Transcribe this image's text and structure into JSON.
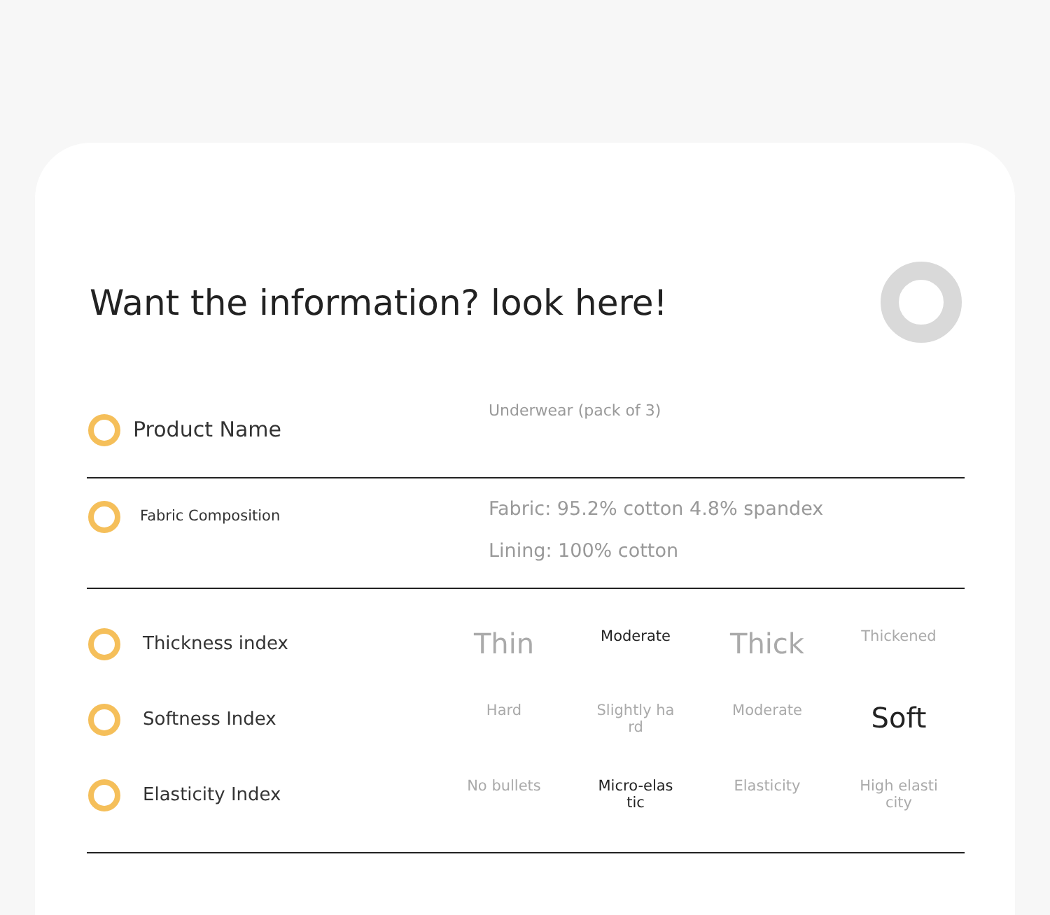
{
  "heading": "Want the information? look here!",
  "details": [
    {
      "label": "Product Name",
      "kind": "large",
      "values": [
        "Underwear (pack of 3)"
      ]
    },
    {
      "label": "Fabric Composition",
      "kind": "small",
      "values": [
        "Fabric: 95.2% cotton 4.8% spandex",
        "Lining: 100% cotton"
      ]
    }
  ],
  "indexes": [
    {
      "label": "Thickness index",
      "options": [
        {
          "text": "Thin",
          "selected": false,
          "emphasis": true
        },
        {
          "text": "Moderate",
          "selected": true,
          "emphasis": false
        },
        {
          "text": "Thick",
          "selected": false,
          "emphasis": true
        },
        {
          "text": "Thickened",
          "selected": false,
          "emphasis": false
        }
      ]
    },
    {
      "label": "Softness Index",
      "options": [
        {
          "text": "Hard",
          "selected": false,
          "emphasis": false
        },
        {
          "text": "Slightly hard",
          "selected": false,
          "emphasis": false
        },
        {
          "text": "Moderate",
          "selected": false,
          "emphasis": false
        },
        {
          "text": "Soft",
          "selected": true,
          "emphasis": true
        }
      ]
    },
    {
      "label": "Elasticity Index",
      "options": [
        {
          "text": "No bullets",
          "selected": false,
          "emphasis": false
        },
        {
          "text": "Micro-elastic",
          "selected": true,
          "emphasis": false
        },
        {
          "text": "Elasticity",
          "selected": false,
          "emphasis": false
        },
        {
          "text": "High elasticity",
          "selected": false,
          "emphasis": false
        }
      ]
    }
  ]
}
